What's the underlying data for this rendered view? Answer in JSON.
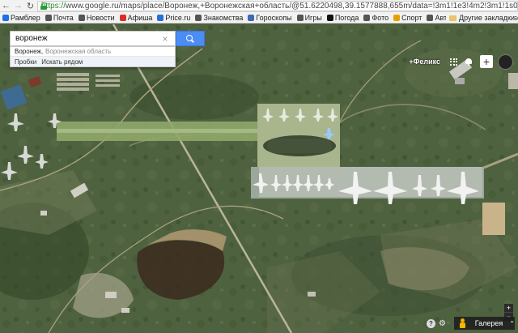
{
  "browser": {
    "nav": {
      "back_icon": "back-arrow-icon",
      "forward_icon": "forward-arrow-icon",
      "reload_icon": "reload-icon"
    },
    "url_scheme": "https://",
    "url_rest": "www.google.ru/maps/place/Воронеж,+Воронежская+область/@51.6220498,39.1577888,655m/data=!3m1!1e3!4m2!3m1!1s0x413b2f5ce874e8",
    "bookmarks": [
      {
        "label": "Рамблер",
        "icon": "rambler-icon",
        "color": "#1a73e8"
      },
      {
        "label": "Почта",
        "icon": "mail-icon",
        "color": "#555555"
      },
      {
        "label": "Новости",
        "icon": "news-icon",
        "color": "#555555"
      },
      {
        "label": "Афиша",
        "icon": "afisha-icon",
        "color": "#d93025"
      },
      {
        "label": "Price.ru",
        "icon": "price-icon",
        "color": "#2a6edb"
      },
      {
        "label": "Знакомства",
        "icon": "dating-icon",
        "color": "#555555"
      },
      {
        "label": "Гороскопы",
        "icon": "horoscope-icon",
        "color": "#3d6bb3"
      },
      {
        "label": "Игры",
        "icon": "games-icon",
        "color": "#555555"
      },
      {
        "label": "Погода",
        "icon": "weather-icon",
        "color": "#111111"
      },
      {
        "label": "Фото",
        "icon": "photo-icon",
        "color": "#555555"
      },
      {
        "label": "Спорт",
        "icon": "sport-icon",
        "color": "#e6a100"
      },
      {
        "label": "Авторамблер",
        "icon": "auto-icon",
        "color": "#555555"
      },
      {
        "label": "Raiffeisen bank",
        "icon": "raiffeisen-icon",
        "color": "#f5e000"
      }
    ],
    "other_bookmarks": "Другие закладки"
  },
  "maps": {
    "search_value": "воронеж",
    "suggestion": {
      "main": "Воронеж,",
      "sub": "Воронежская область"
    },
    "suggestion_links": [
      "Пробки",
      "Искать рядом"
    ],
    "user_name": "+Феликс",
    "share_label": "+",
    "zoom_in": "+",
    "zoom_out": "−",
    "help_label": "?",
    "settings_icon": "⚙",
    "gallery_label": "Галерея",
    "gallery_chevron": "⌃",
    "accent": "#4b8cf5"
  }
}
